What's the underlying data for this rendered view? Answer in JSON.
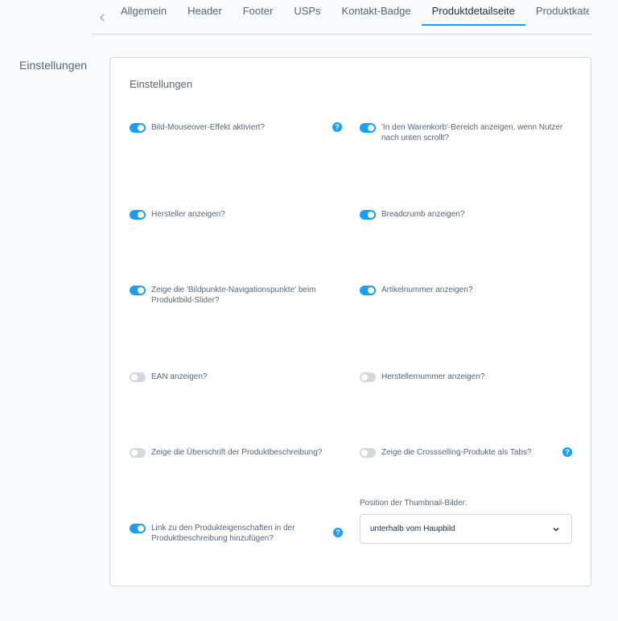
{
  "tabs": {
    "items": [
      "Allgemein",
      "Header",
      "Footer",
      "USPs",
      "Kontakt-Badge",
      "Produktdetailseite",
      "Produktkategorie"
    ],
    "active_index": 5
  },
  "section_label": "Einstellungen",
  "card": {
    "title": "Einstellungen",
    "fields": [
      {
        "label": "Bild-Mouseover-Effekt aktiviert?",
        "enabled": true,
        "help": true
      },
      {
        "label": "'In den Warenkorb'-Bereich anzeigen, wenn Nutzer nach unten scrollt?",
        "enabled": true,
        "help": false
      },
      {
        "label": "Hersteller anzeigen?",
        "enabled": true,
        "help": false
      },
      {
        "label": "Breadcrumb anzeigen?",
        "enabled": true,
        "help": false
      },
      {
        "label": "Zeige die 'Bildpunkte-Navigationspunkte' beim Produktbild-Slider?",
        "enabled": true,
        "help": false
      },
      {
        "label": "Artikelnummer anzeigen?",
        "enabled": true,
        "help": false
      },
      {
        "label": "EAN anzeigen?",
        "enabled": false,
        "help": false
      },
      {
        "label": "Herstellernummer anzeigen?",
        "enabled": false,
        "help": false
      },
      {
        "label": "Zeige die Überschrift der Produktbeschreibung?",
        "enabled": false,
        "help": false
      },
      {
        "label": "Zeige die Crossselling-Produkte als Tabs?",
        "enabled": false,
        "help": true
      },
      {
        "label": "Link zu den Produkteigenschaften in der Produktbeschreibung hinzufügen?",
        "enabled": true,
        "help": true
      }
    ],
    "thumbnail_select": {
      "label": "Position der Thumbnail-Bilder:",
      "value": "unterhalb vom Haupbild"
    }
  },
  "icons": {
    "tab_prev": "chevron-left-icon",
    "tab_next": "chevron-right-icon",
    "help": "question-mark-icon",
    "select": "chevron-down-icon"
  },
  "colors": {
    "accent": "#189eff",
    "toggle_off": "#d1d9e0",
    "text": "#52667a",
    "border": "#d1d9e0"
  }
}
